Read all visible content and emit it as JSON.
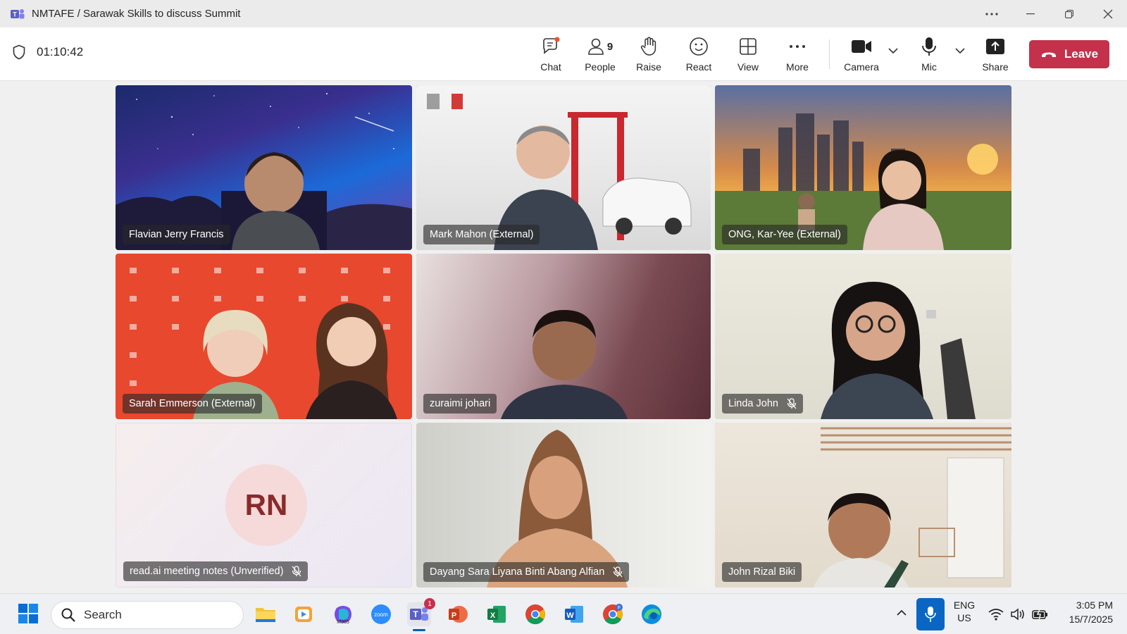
{
  "window": {
    "title": "NMTAFE / Sarawak Skills to discuss Summit"
  },
  "toolbar": {
    "timer": "01:10:42",
    "buttons": {
      "chat": "Chat",
      "people": "People",
      "people_count": "9",
      "raise": "Raise",
      "react": "React",
      "view": "View",
      "more": "More",
      "camera": "Camera",
      "mic": "Mic",
      "share": "Share"
    },
    "leave_label": "Leave"
  },
  "participants": [
    {
      "name": "Flavian Jerry Francis",
      "muted": false,
      "speaking": false
    },
    {
      "name": "Mark Mahon (External)",
      "muted": false,
      "speaking": true
    },
    {
      "name": "ONG, Kar-Yee (External)",
      "muted": false,
      "speaking": true
    },
    {
      "name": "Sarah Emmerson (External)",
      "muted": false,
      "speaking": false
    },
    {
      "name": "zuraimi johari",
      "muted": false,
      "speaking": true
    },
    {
      "name": "Linda John",
      "muted": true,
      "speaking": false
    },
    {
      "name": "read.ai meeting notes (Unverified)",
      "muted": true,
      "speaking": false,
      "initials": "RN"
    },
    {
      "name": "Dayang Sara Liyana Binti Abang Alfian",
      "muted": true,
      "speaking": false
    },
    {
      "name": "John Rizal Biki",
      "muted": false,
      "speaking": true
    }
  ],
  "taskbar": {
    "search_placeholder": "Search",
    "teams_badge": "1",
    "language": "ENG",
    "region": "US",
    "time": "3:05 PM",
    "date": "15/7/2025"
  },
  "colors": {
    "accent": "#5b5fc7",
    "leave": "#c4314b"
  }
}
